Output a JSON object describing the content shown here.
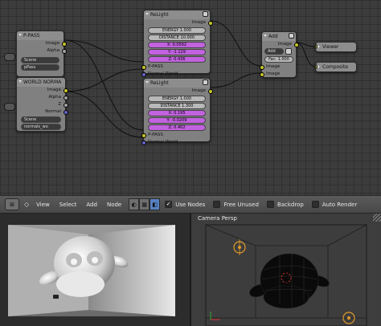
{
  "nodes": {
    "rl_pass": {
      "title": "P-PASS",
      "outputs": [
        "Image",
        "Alpha"
      ],
      "scene_value": "Scene",
      "pass_value": "pPass"
    },
    "rl_normal": {
      "title": "WORLD NORMA",
      "outputs": [
        "Image",
        "Alpha",
        "Z",
        "Normal"
      ],
      "scene_value": "Scene",
      "pass_value": "normals_wo"
    },
    "relight1": {
      "title": "ReLight",
      "output": "Image",
      "energy": "ENERGY 1.000",
      "distance": "DISTANCE 10.000",
      "x": "X: 0.0562",
      "y": "Y: -1.129",
      "z": "Z: 0.436",
      "in_ppass": "P-PASS",
      "in_normal": "Normal World"
    },
    "relight2": {
      "title": "ReLight",
      "output": "Image",
      "energy": "ENERGY 1.000",
      "distance": "DISTANCE 1.300",
      "x": "X: 0.195",
      "y": "Y: -0.0209",
      "z": "Z: 0.402",
      "in_ppass": "P-PASS",
      "in_normal": "Normal World"
    },
    "add": {
      "title": "Add",
      "output": "Image",
      "blend": "Add",
      "fac": "Fac: 1.000",
      "in1": "Image",
      "in2": "Image"
    },
    "viewer": {
      "title": "Viewer"
    },
    "composite": {
      "title": "Composite"
    }
  },
  "toolbar": {
    "menus": [
      "View",
      "Select",
      "Add",
      "Node"
    ],
    "use_nodes": "Use Nodes",
    "free_unused": "Free Unused",
    "backdrop": "Backdrop",
    "auto_render": "Auto Render",
    "use_nodes_checked": true,
    "free_unused_checked": false,
    "backdrop_checked": false,
    "auto_render_checked": false
  },
  "viewport": {
    "camera_label": "Camera Persp"
  },
  "colors": {
    "relight_header": "#3b7a5e",
    "renderlayer_header": "#a6294a",
    "field_purple": "#c262e0",
    "socket_yellow": "#c7c729",
    "socket_violet": "#6363c7",
    "active_blue": "#5680c2"
  },
  "icons": {
    "editor_type": "node-editor-icon",
    "tree_types": [
      "shader-tree-icon",
      "texture-tree-icon",
      "compositing-tree-icon"
    ]
  }
}
